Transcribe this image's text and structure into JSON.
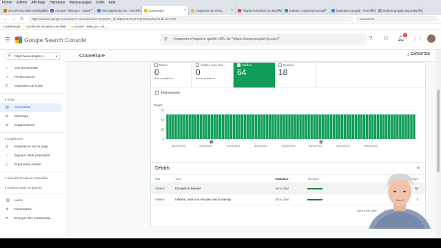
{
  "browser": {
    "menu": [
      "Fichier",
      "Édition",
      "Affichage",
      "Historique",
      "Marque-pages",
      "Outils",
      "Aide"
    ],
    "tabs": [
      {
        "label": "Je crée ma veille stratégique",
        "fav": "#e37400"
      },
      {
        "label": "Accueil - lelse.pro - Stripe",
        "fav": "#635bff"
      },
      {
        "label": "site:playlist-dj.com - Recherche",
        "fav": "#4285f4"
      },
      {
        "label": "Couverture",
        "fav": "#fbbc04"
      },
      {
        "label": "Inspection de l'URL",
        "fav": "#fbbc04"
      },
      {
        "label": "Playlist Réveillon 31 décembre 2",
        "fav": "#ea4335"
      },
      {
        "label": "Indexer, crawl and recrawl",
        "fav": "#34a853"
      },
      {
        "label": "indexation google - Recherche",
        "fav": "#4285f4"
      },
      {
        "label": "Robots-google.png.webp (image)",
        "fav": "#9aa0a6"
      }
    ],
    "url": "https://search.google.com/search-console/index?resource_id=https%3A%2F%2Fwww.playlist-dj.com%2F",
    "omni_hint": "inscruction",
    "bookmarks": [
      "polefonoex",
      "Boîte de réception (18 568)",
      "Accueil - lelse.pro - St..."
    ]
  },
  "header": {
    "app_name": "Google Search Console",
    "inspect_placeholder": "Inspecter n'importe quelle URL de \"https://www.playlist-dj.com/\"",
    "notif_count": "3"
  },
  "sidebar": {
    "property": "https://www.playlist.c...",
    "items_top": [
      {
        "label": "Vue d'ensemble",
        "icon": "home-icon",
        "glyph": "⌂"
      },
      {
        "label": "Performances",
        "icon": "trend-icon",
        "glyph": "↗"
      },
      {
        "label": "Inspection de l'URL",
        "icon": "search-icon",
        "glyph": "⚲"
      }
    ],
    "section_index": "Index",
    "items_index": [
      {
        "label": "Couverture",
        "icon": "coverage-icon",
        "glyph": "▤",
        "active": true
      },
      {
        "label": "Sitemaps",
        "icon": "sitemap-icon",
        "glyph": "⊞"
      },
      {
        "label": "Suppressions",
        "icon": "remove-icon",
        "glyph": "⊘"
      }
    ],
    "section_experience": "Expérience",
    "items_experience": [
      {
        "label": "Expérience sur la page",
        "icon": "page-icon",
        "glyph": "◎"
      },
      {
        "label": "Signaux Web essentiels",
        "icon": "speed-icon",
        "glyph": "◔"
      },
      {
        "label": "Ergonomie mobile",
        "icon": "mobile-icon",
        "glyph": "▯"
      }
    ],
    "section_security": "Sécurité et actions manuelles",
    "section_legacy": "Anciens outils et rapports",
    "items_bottom": [
      {
        "label": "Liens",
        "icon": "links-icon",
        "glyph": "⛓"
      },
      {
        "label": "Paramètres",
        "icon": "settings-icon",
        "glyph": "⚙"
      },
      {
        "label": "Envoyer des commentai...",
        "icon": "feedback-icon",
        "glyph": "✉"
      }
    ]
  },
  "main": {
    "title": "Couverture",
    "export_label": "EXPORTER",
    "stats": [
      {
        "label": "Erreur",
        "value": "0",
        "sub": "Aucun problème",
        "selected": false
      },
      {
        "label": "Valides avec des...",
        "value": "0",
        "sub": "Aucun problème",
        "selected": false
      },
      {
        "label": "Valides",
        "value": "64",
        "sub": "",
        "selected": true
      },
      {
        "label": "Exclues",
        "value": "18",
        "sub": "",
        "selected": false
      }
    ],
    "impressions_label": "Impressions",
    "details_title": "Détails",
    "table_headers": [
      "État",
      "Type",
      "Validation",
      "Tendance",
      "Pages"
    ],
    "rows": [
      {
        "status": "Valides",
        "type": "Envoyée et indexée",
        "validation": "Sans objet",
        "pages": "60"
      },
      {
        "status": "Valides",
        "type": "Indexée, mais non envoyée via un sitemap",
        "validation": "Sans objet",
        "pages": "4"
      }
    ],
    "pager": {
      "rows_label": "Lignes par page :",
      "rows_value": "10",
      "range": "1-2 sur 2"
    }
  },
  "chart_data": {
    "type": "bar",
    "ylabel": "Pages",
    "ylim": [
      0,
      75
    ],
    "yticks": [
      0,
      25,
      50,
      75
    ],
    "xticks": [
      "16/10/2021",
      "31/10/2021",
      "15/11/2021",
      "30/11/2021",
      "15/12/2021",
      "30/12/2021",
      "14/01/2022",
      "29/01/2022"
    ],
    "annotations": [
      {
        "label": "1",
        "at_tick": 1.3
      },
      {
        "label": "1",
        "at_tick": 5.3
      }
    ],
    "bar_count": 90,
    "series": [
      {
        "color": "#0f9d58",
        "values": [
          64,
          64,
          64,
          64,
          64,
          64,
          64,
          64,
          64,
          64,
          64,
          64,
          64,
          64,
          64,
          64,
          64,
          64,
          64,
          64,
          64,
          64,
          64,
          64,
          64,
          64,
          64,
          64,
          64,
          64,
          64,
          64,
          64,
          64,
          64,
          64,
          64,
          64,
          64,
          64,
          64,
          64,
          64,
          64,
          64,
          64,
          64,
          64,
          64,
          64,
          64,
          64,
          64,
          64,
          64,
          64,
          64,
          64,
          64,
          64,
          64,
          64,
          64,
          64,
          64,
          64,
          64,
          64,
          64,
          64,
          64,
          64,
          64,
          64,
          64,
          64,
          64,
          64,
          64,
          64,
          64,
          64,
          64,
          64,
          64,
          64,
          64,
          64,
          64,
          64
        ]
      }
    ]
  }
}
